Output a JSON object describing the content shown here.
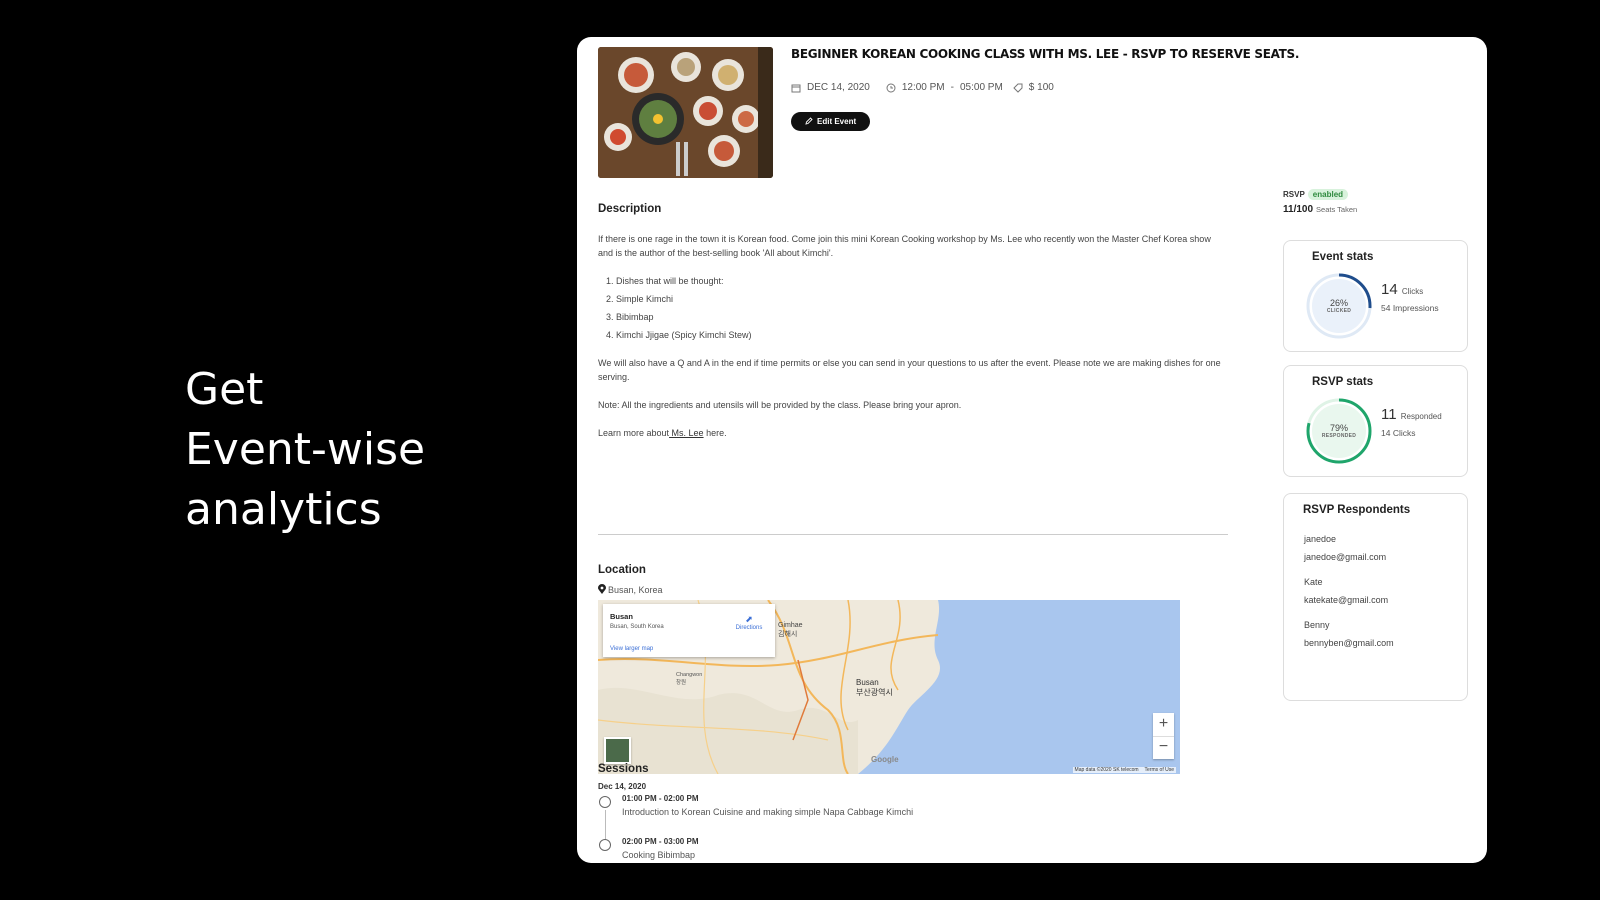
{
  "headline": [
    "Get",
    "Event-wise",
    "analytics"
  ],
  "event": {
    "title": "BEGINNER KOREAN COOKING CLASS WITH MS. LEE - RSVP TO RESERVE SEATS.",
    "date": "DEC 14, 2020",
    "time_start": "12:00 PM",
    "time_sep": "-",
    "time_end": "05:00 PM",
    "price": "$ 100",
    "edit_label": "Edit Event"
  },
  "description": {
    "heading": "Description",
    "intro": "If there is one rage in the town it is Korean food. Come join this mini Korean Cooking workshop by Ms. Lee who recently won the Master Chef Korea show and is the author of the best-selling book 'All about Kimchi'.",
    "list": [
      "Dishes that will be thought:",
      "Simple Kimchi",
      "Bibimbap",
      "Kimchi Jjigae (Spicy Kimchi Stew)"
    ],
    "qa": "We will also have a Q and A in the end if time permits or else you can send in your questions to us after the event. Please note we are making dishes for one serving.",
    "note": "Note: All the ingredients and utensils will be provided by the class. Please bring your apron.",
    "learn_prefix": "Learn more about",
    "learn_link": " Ms. Lee",
    "learn_suffix": " here."
  },
  "location": {
    "heading": "Location",
    "place": "Busan, Korea",
    "map": {
      "popup_title": "Busan",
      "popup_sub": "Busan, South Korea",
      "directions": "Directions",
      "larger": "View larger map",
      "city_label": "Busan",
      "city_label_ko": "부산광역시",
      "gimhae": "Gimhae",
      "gimhae_ko": "김해시",
      "changwon": "Changwon",
      "changwon_ko": "창원",
      "zoom_in": "+",
      "zoom_out": "−",
      "attribution": "Map data ©2020 SK telecom",
      "terms": "Terms of Use",
      "google": "Google"
    }
  },
  "sessions": {
    "heading": "Sessions",
    "date": "Dec 14, 2020",
    "items": [
      {
        "time": "01:00 PM - 02:00 PM",
        "desc": "Introduction to Korean Cuisine and making simple Napa Cabbage Kimchi"
      },
      {
        "time": "02:00 PM - 03:00 PM",
        "desc": "Cooking Bibimbap"
      }
    ]
  },
  "rsvp": {
    "label": "RSVP",
    "status": "enabled",
    "seats": "11/100",
    "seats_label": "Seats Taken"
  },
  "event_stats": {
    "title": "Event stats",
    "percent": 0.26,
    "percent_label": "26%",
    "ring_label": "CLICKED",
    "big": "14",
    "big_label": "Clicks",
    "sub": "54 Impressions"
  },
  "rsvp_stats": {
    "title": "RSVP stats",
    "percent": 0.79,
    "percent_label": "79%",
    "ring_label": "RESPONDED",
    "big": "11",
    "big_label": "Responded",
    "sub": "14 Clicks"
  },
  "respondents": {
    "title": "RSVP Respondents",
    "items": [
      {
        "name": "janedoe",
        "email": "janedoe@gmail.com"
      },
      {
        "name": "Kate",
        "email": "katekate@gmail.com"
      },
      {
        "name": "Benny",
        "email": "bennyben@gmail.com"
      }
    ]
  },
  "colors": {
    "ring1": "#1f4d8c",
    "ring2": "#1fa56b",
    "ring_bg": "#dfe9f5",
    "ring2_bg": "#dff3e6"
  }
}
